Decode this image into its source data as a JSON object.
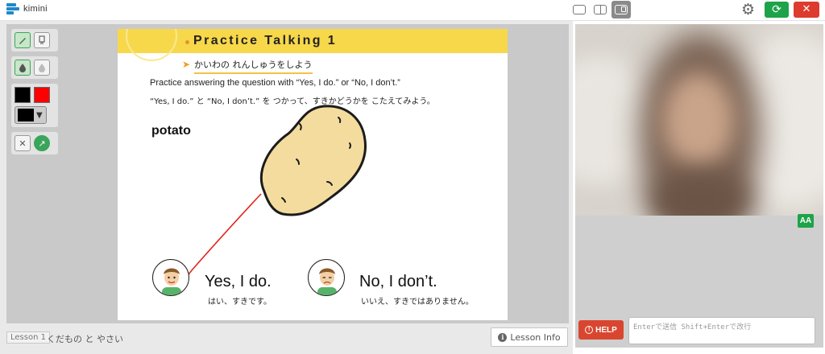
{
  "app": {
    "name": "kimini"
  },
  "header": {
    "layout_buttons": [
      {
        "icon": "layout-single-icon",
        "active": false
      },
      {
        "icon": "layout-split-icon",
        "active": false
      },
      {
        "icon": "layout-pip-icon",
        "active": true
      }
    ],
    "settings_icon": "gear-icon",
    "refresh_icon": "refresh-icon",
    "close_icon": "close-icon",
    "refresh_glyph": "⟳",
    "close_glyph": "✕",
    "gear_glyph": "⚙"
  },
  "tools": {
    "pen_icon": "pen-icon",
    "eraser_icon": "eraser-icon",
    "drop_fill_icon": "drop-filled-icon",
    "drop_outline_icon": "drop-outline-icon",
    "colors": [
      "#000000",
      "#ff0000"
    ],
    "selected_color": "#000000",
    "clear_glyph": "✕",
    "go_glyph": "↗"
  },
  "slide": {
    "title": "Practice Talking 1",
    "subtitle": "かいわの れんしゅうをしよう",
    "instruction_en": "Practice answering the question with “Yes, I do.” or “No, I don’t.”",
    "instruction_jp": "“Yes, I do.” と “No, I don’t.” を つかって、すきかどうかを こたえてみよう。",
    "word": "potato",
    "answers": [
      {
        "en": "Yes, I do.",
        "jp": "はい、すきです。",
        "mood": "happy"
      },
      {
        "en": "No, I don’t.",
        "jp": "いいえ、すきではありません。",
        "mood": "sad"
      }
    ]
  },
  "footer": {
    "lesson_tag": "Lesson 1",
    "lesson_name": "くだもの と やさい",
    "lesson_info_label": "Lesson Info",
    "info_glyph": "i"
  },
  "chat": {
    "font_size_label": "AA",
    "help_label": "HELP",
    "help_glyph": "!",
    "input_placeholder": "Enterで送信 Shift+Enterで改行",
    "input_value": ""
  },
  "colors": {
    "accent_green": "#1ea34a",
    "danger_red": "#dd3b2e",
    "slide_header_yellow": "#f7d84a",
    "brand_blue": "#1e88c9"
  }
}
